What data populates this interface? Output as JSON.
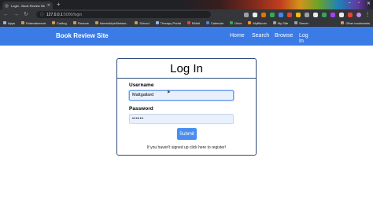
{
  "browser": {
    "tab_title": "Login - Book Review Site",
    "new_tab": "+",
    "address": {
      "host": "127.0.0.1",
      "path": ":5000/login"
    },
    "bookmarks": [
      "Apps",
      "Entertainment",
      "Coding",
      "Finance",
      "Internships/Networ...",
      "School",
      "Therapy Portal",
      "EMail",
      "Calendar",
      "Drive",
      "MyBitcoin",
      "My Site",
      "Server"
    ],
    "other_bookmarks": "Other bookmarks"
  },
  "site": {
    "brand": "Book Review Site",
    "nav": {
      "home": "Home",
      "search": "Search",
      "browse": "Browse",
      "login": "Log In"
    }
  },
  "login": {
    "title": "Log In",
    "username_label": "Username",
    "username_value": "Mattgallard",
    "password_label": "Password",
    "password_value": "••••••",
    "submit_label": "Submit",
    "signup_text": "If you haven't signed up click here to register!"
  },
  "colors": {
    "navbar": "#3b7be6",
    "button": "#4a8df0",
    "input_bg": "#e8f0fe"
  }
}
